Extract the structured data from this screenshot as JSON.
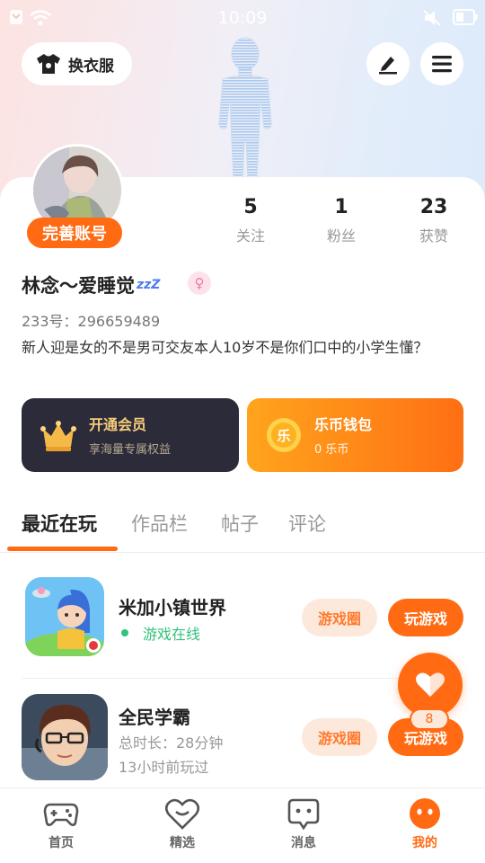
{
  "status_bar": {
    "time": "10:09"
  },
  "header": {
    "dress_up_label": "换衣服"
  },
  "profile": {
    "complete_account_label": "完善账号",
    "stats": [
      {
        "value": "5",
        "label": "关注"
      },
      {
        "value": "1",
        "label": "粉丝"
      },
      {
        "value": "23",
        "label": "获赞"
      }
    ],
    "name": "林念～爱睡觉",
    "name_suffix": "zzZ",
    "gender_symbol": "♀",
    "id_text": "233号：296659489",
    "bio": "新人迎是女的不是男可交友本人10岁不是你们口中的小学生懂？"
  },
  "promos": {
    "vip": {
      "title": "开通会员",
      "subtitle": "享海量专属权益"
    },
    "wallet": {
      "title": "乐币钱包",
      "subtitle": "0 乐币",
      "coin_glyph": "乐"
    }
  },
  "tabs": [
    {
      "label": "最近在玩",
      "active": true
    },
    {
      "label": "作品栏",
      "active": false
    },
    {
      "label": "帖子",
      "active": false
    },
    {
      "label": "评论",
      "active": false
    }
  ],
  "games": [
    {
      "title": "米加小镇世界",
      "status": "游戏在线",
      "circle_label": "游戏圈",
      "play_label": "玩游戏"
    },
    {
      "title": "全民学霸",
      "duration": "总时长：28分钟",
      "last_played": "13小时前玩过",
      "circle_label": "游戏圈",
      "play_label": "玩游戏"
    }
  ],
  "like_fab": {
    "count": "8"
  },
  "bottom_nav": [
    {
      "label": "首页",
      "icon": "gamepad-icon",
      "active": false
    },
    {
      "label": "精选",
      "icon": "heart-badge-icon",
      "active": false
    },
    {
      "label": "消息",
      "icon": "chat-icon",
      "active": false
    },
    {
      "label": "我的",
      "icon": "profile-face-icon",
      "active": true
    }
  ],
  "colors": {
    "accent": "#ff6a13",
    "online": "#31c27c",
    "vip_bg": "#2b2b3a"
  }
}
